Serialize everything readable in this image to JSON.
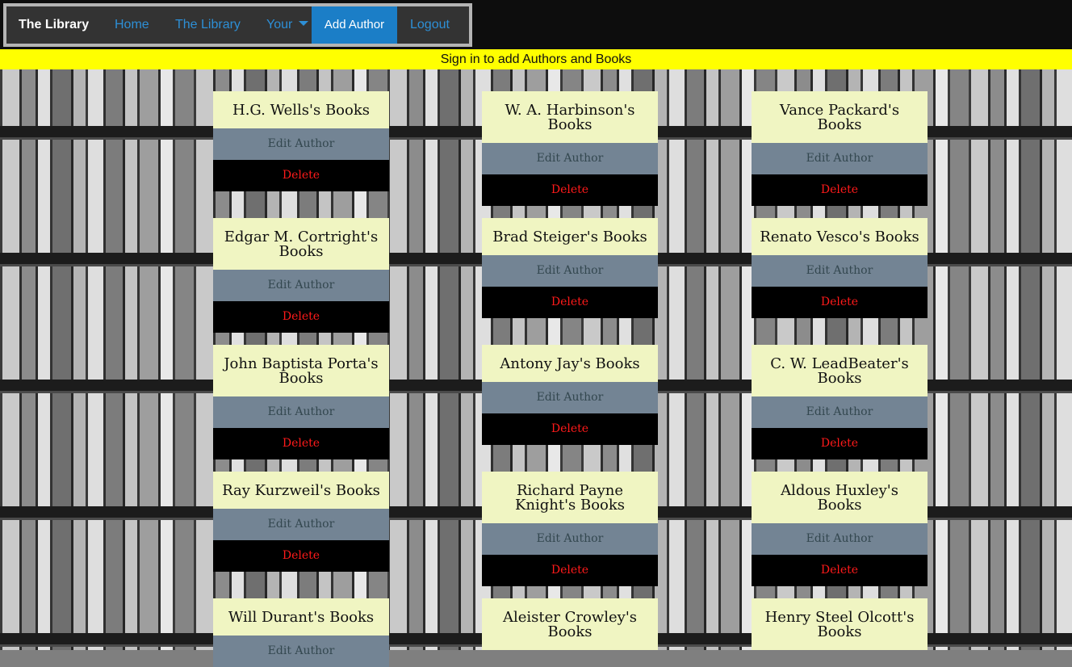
{
  "nav": {
    "brand": "The Library",
    "home": "Home",
    "library": "The Library",
    "your": "Your",
    "add_author": "Add Author",
    "logout": "Logout"
  },
  "notice": "Sign in to add Authors and Books",
  "card_actions": {
    "edit": "Edit Author",
    "delete": "Delete"
  },
  "authors": [
    "H.G. Wells's Books",
    "W. A. Harbinson's Books",
    "Vance Packard's Books",
    "Edgar M. Cortright's Books",
    "Brad Steiger's Books",
    "Renato Vesco's Books",
    "John Baptista Porta's Books",
    "Antony Jay's Books",
    "C. W. LeadBeater's Books",
    "Ray Kurzweil's Books",
    "Richard Payne Knight's Books",
    "Aldous Huxley's Books",
    "Will Durant's Books",
    "Aleister Crowley's Books",
    "Henry Steel Olcott's Books"
  ],
  "colors": {
    "notice_bg": "#ffff00",
    "card_title_bg": "#f0f5c2",
    "edit_bg": "#738494",
    "delete_text": "#ff1a1a",
    "nav_link": "#2d8fd6",
    "add_author_bg": "#1b7ec7"
  }
}
